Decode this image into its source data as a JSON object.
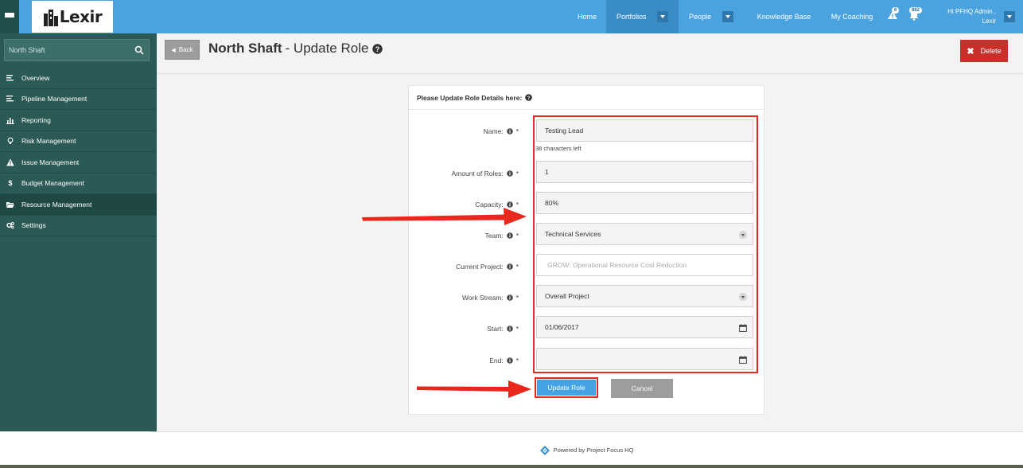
{
  "brand": {
    "name": "Lexir"
  },
  "nav": {
    "items": [
      {
        "label": "Home",
        "active": false,
        "dropdown": false
      },
      {
        "label": "Portfolios",
        "active": true,
        "dropdown": true
      },
      {
        "label": "People",
        "active": false,
        "dropdown": true
      },
      {
        "label": "Knowledge Base",
        "active": false,
        "dropdown": false
      },
      {
        "label": "My Coaching",
        "active": false,
        "dropdown": false
      }
    ],
    "alerts_count": "6",
    "notifications_count": "882",
    "user_greeting_line1": "Hi PFHQ Admin ,",
    "user_greeting_line2": "Lexir"
  },
  "sidebar": {
    "search_placeholder": "North Shaft",
    "items": [
      {
        "label": "Overview",
        "icon": "list-icon",
        "active": false
      },
      {
        "label": "Pipeline Management",
        "icon": "list-icon",
        "active": false
      },
      {
        "label": "Reporting",
        "icon": "bar-chart-icon",
        "active": false
      },
      {
        "label": "Risk Management",
        "icon": "lightbulb-icon",
        "active": false
      },
      {
        "label": "Issue Management",
        "icon": "warning-icon",
        "active": false
      },
      {
        "label": "Budget Management",
        "icon": "dollar-icon",
        "active": false
      },
      {
        "label": "Resource Management",
        "icon": "folder-icon",
        "active": true
      },
      {
        "label": "Settings",
        "icon": "gears-icon",
        "active": false
      }
    ]
  },
  "page": {
    "back_label": "Back",
    "title_bold": "North Shaft",
    "title_rest": "- Update Role",
    "delete_label": "Delete"
  },
  "form": {
    "heading": "Please Update Role Details here:",
    "fields": [
      {
        "label": "Name:",
        "value": "Testing Lead",
        "type": "text"
      },
      {
        "label": "Amount of Roles:",
        "value": "1",
        "type": "text"
      },
      {
        "label": "Capacity:",
        "value": "80%",
        "type": "text"
      },
      {
        "label": "Team:",
        "value": "Technical Services",
        "type": "select"
      },
      {
        "label": "Current Project:",
        "value": "GROW: Operational Resource Cost Reduction",
        "type": "disabled"
      },
      {
        "label": "Work Stream:",
        "value": "Overall Project",
        "type": "select"
      },
      {
        "label": "Start:",
        "value": "01/06/2017",
        "type": "date"
      },
      {
        "label": "End:",
        "value": "",
        "type": "date"
      }
    ],
    "required_marker": "*",
    "chars_left": "38 characters left",
    "update_label": "Update Role",
    "cancel_label": "Cancel"
  },
  "footer": {
    "text": "Powered by Project Focus HQ"
  },
  "colors": {
    "topbar": "#4aa3df",
    "sidebar": "#2b5955",
    "annotation": "#e8281c",
    "primary_button": "#45a3e4",
    "delete_button": "#c9302c"
  }
}
